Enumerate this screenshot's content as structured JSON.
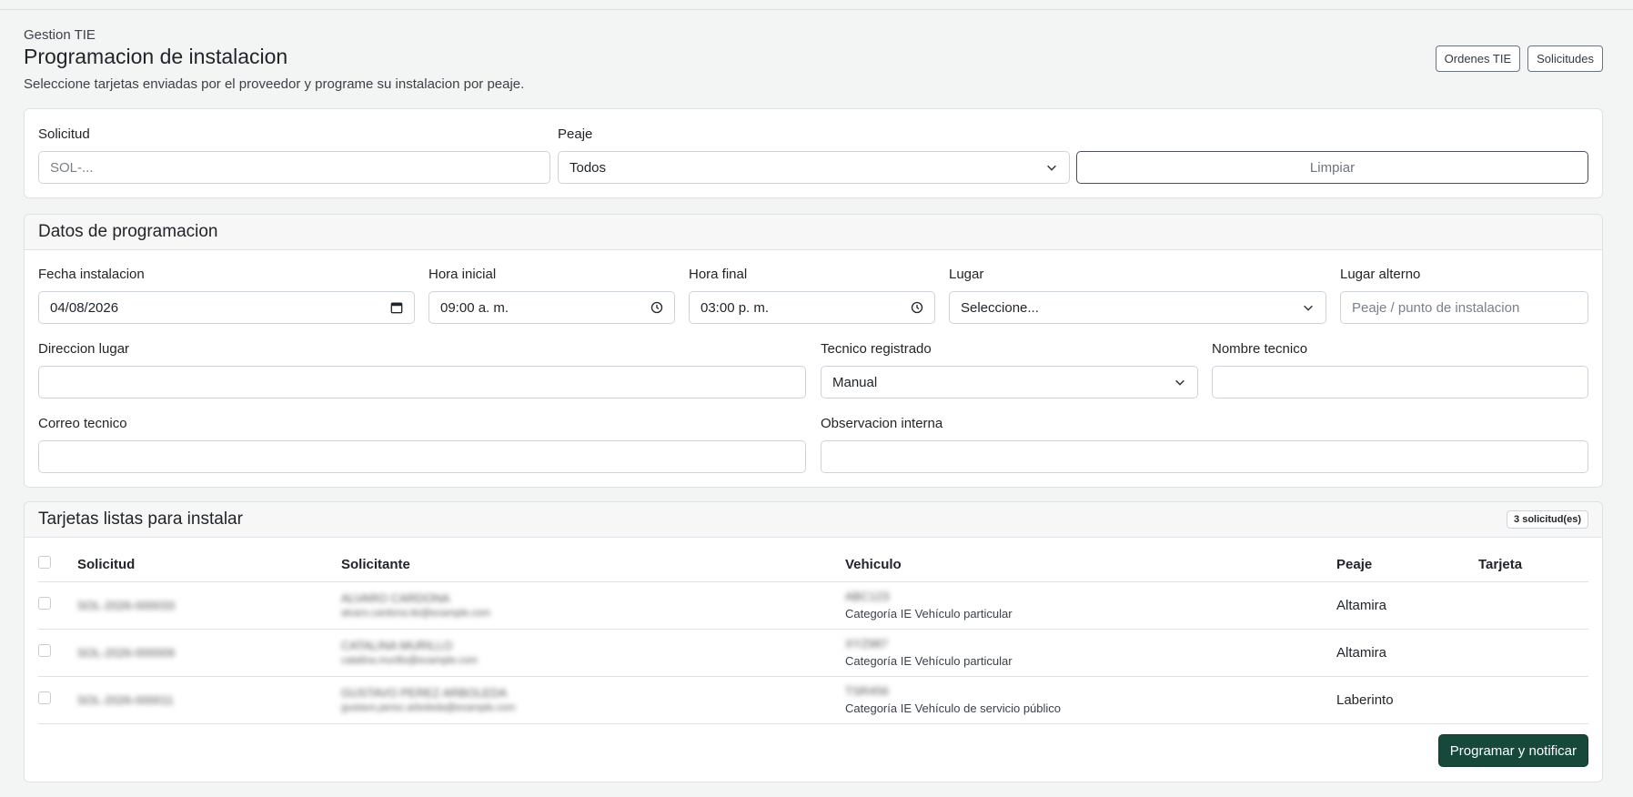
{
  "header": {
    "breadcrumb": "Gestion TIE",
    "title": "Programacion de instalacion",
    "subtitle": "Seleccione tarjetas enviadas por el proveedor y programe su instalacion por peaje.",
    "actions": [
      "Ordenes TIE",
      "Solicitudes"
    ]
  },
  "filters": {
    "solicitud_label": "Solicitud",
    "solicitud_placeholder": "SOL-...",
    "peaje_label": "Peaje",
    "peaje_value": "Todos",
    "clear_label": "Limpiar"
  },
  "programacion": {
    "title": "Datos de programacion",
    "fecha_label": "Fecha instalacion",
    "fecha_value": "04/08/2026",
    "hora_inicial_label": "Hora inicial",
    "hora_inicial_value": "09:00 a. m.",
    "hora_final_label": "Hora final",
    "hora_final_value": "03:00 p. m.",
    "lugar_label": "Lugar",
    "lugar_value": "Seleccione...",
    "lugar_alterno_label": "Lugar alterno",
    "lugar_alterno_placeholder": "Peaje / punto de instalacion",
    "direccion_label": "Direccion lugar",
    "tecnico_label": "Tecnico registrado",
    "tecnico_value": "Manual",
    "nombre_tecnico_label": "Nombre tecnico",
    "correo_label": "Correo tecnico",
    "observacion_label": "Observacion interna"
  },
  "tarjetas": {
    "title": "Tarjetas listas para instalar",
    "count_badge": "3 solicitud(es)",
    "columns": [
      "Solicitud",
      "Solicitante",
      "Vehiculo",
      "Peaje",
      "Tarjeta"
    ],
    "rows": [
      {
        "solicitud": "SOL-2026-000033",
        "solicitante": "ALVARO CARDONA",
        "email": "alvaro.cardona.tie@example.com",
        "placa": "ABC123",
        "categoria": "Categoría IE Vehículo particular",
        "peaje": "Altamira",
        "tarjeta": ""
      },
      {
        "solicitud": "SOL-2026-000009",
        "solicitante": "CATALINA MURILLO",
        "email": "catalina.murillo@example.com",
        "placa": "XYZ987",
        "categoria": "Categoría IE Vehículo particular",
        "peaje": "Altamira",
        "tarjeta": ""
      },
      {
        "solicitud": "SOL-2026-000011",
        "solicitante": "GUSTAVO PEREZ ARBOLEDA",
        "email": "gustavo.perez.arboleda@example.com",
        "placa": "TSR456",
        "categoria": "Categoría IE Vehículo de servicio público",
        "peaje": "Laberinto",
        "tarjeta": ""
      }
    ],
    "submit_label": "Programar y notificar"
  }
}
